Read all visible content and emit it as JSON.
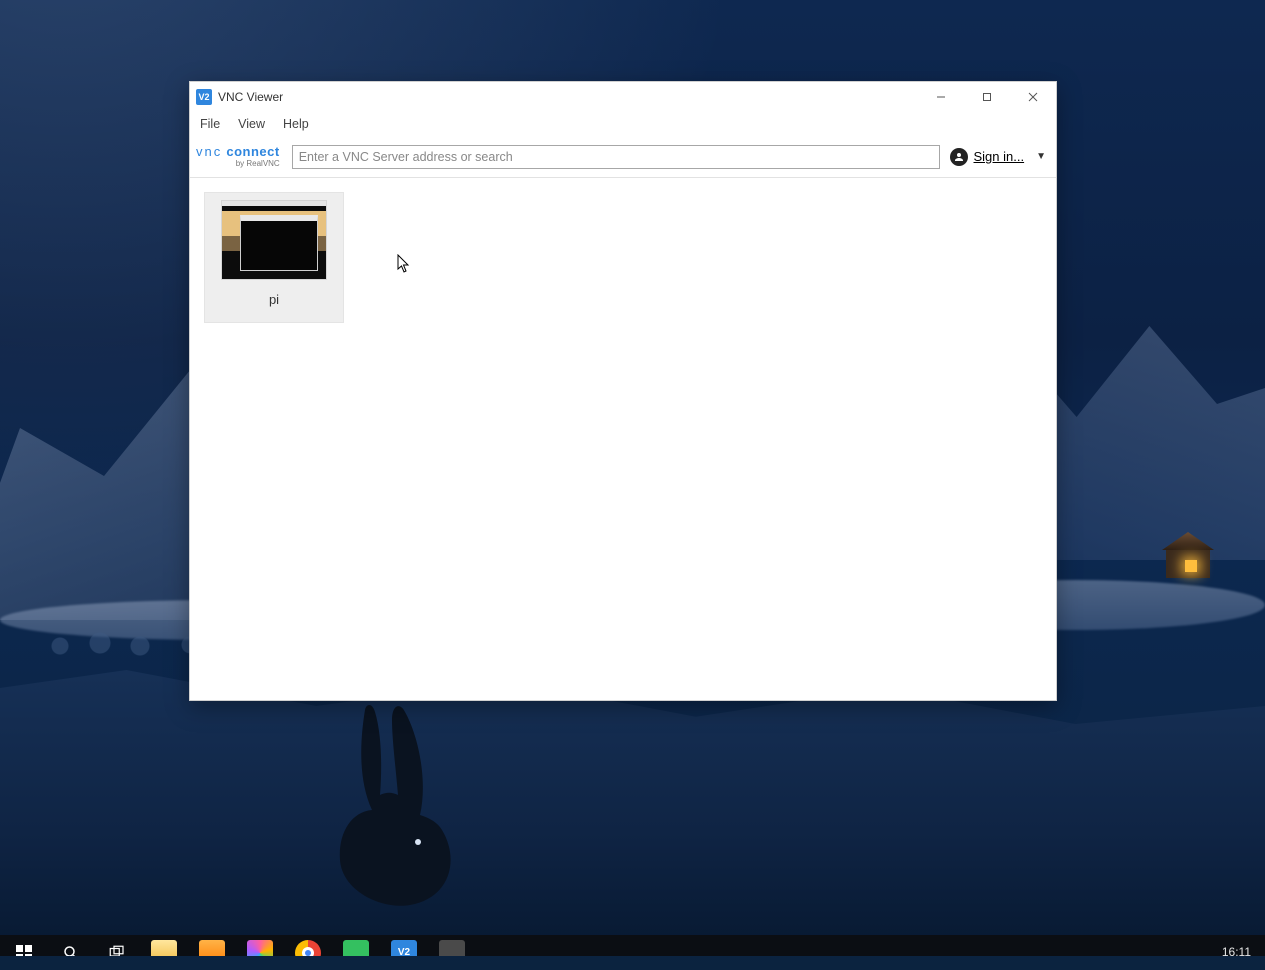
{
  "window": {
    "title": "VNC Viewer",
    "app_icon_text": "V2",
    "menu": {
      "file": "File",
      "view": "View",
      "help": "Help"
    },
    "logo": {
      "line1_thin": "vnc",
      "line1_bold": "connect",
      "sub": "by RealVNC"
    },
    "address_placeholder": "Enter a VNC Server address or search",
    "signin_label": "Sign in..."
  },
  "connections": [
    {
      "label": "pi"
    }
  ],
  "taskbar": {
    "clock": "16:11"
  }
}
